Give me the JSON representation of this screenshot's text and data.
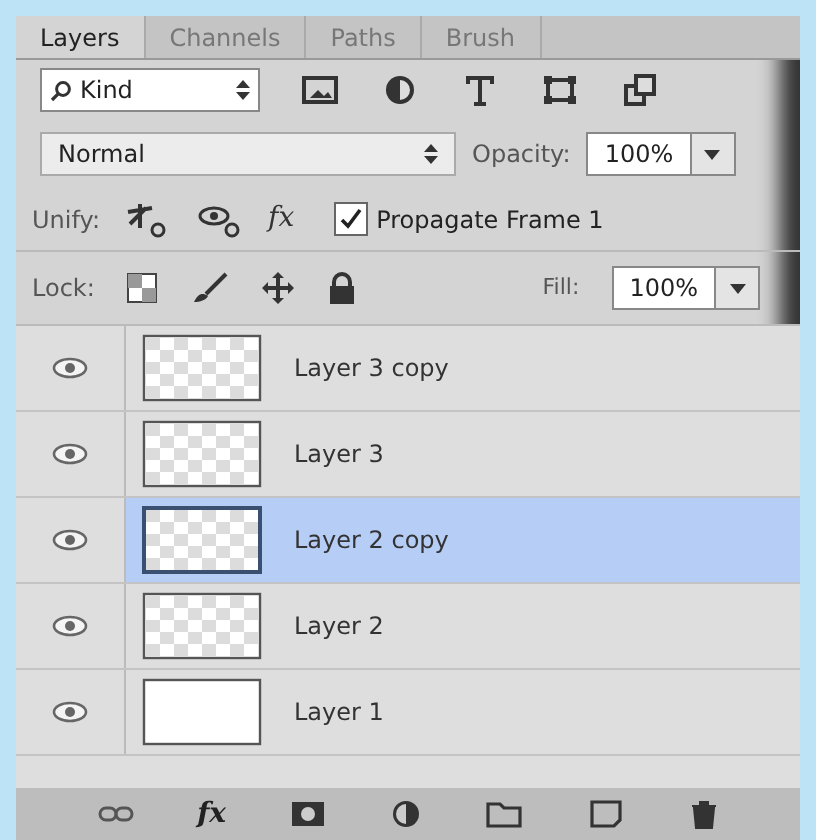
{
  "tabs": [
    {
      "label": "Layers",
      "selected": true
    },
    {
      "label": "Channels",
      "selected": false
    },
    {
      "label": "Paths",
      "selected": false
    },
    {
      "label": "Brush",
      "selected": false
    }
  ],
  "filter": {
    "value": "Kind"
  },
  "blend": {
    "mode": "Normal",
    "opacity_label": "Opacity:",
    "opacity": "100%"
  },
  "unify": {
    "label": "Unify:",
    "style_label": "fx",
    "propagate": {
      "label": "Propagate Frame 1",
      "checked": true
    }
  },
  "lock": {
    "label": "Lock:",
    "fill_label": "Fill:",
    "fill": "100%"
  },
  "layers": [
    {
      "name": "Layer 3 copy",
      "visible": true,
      "selected": false,
      "transparent": true
    },
    {
      "name": "Layer 3",
      "visible": true,
      "selected": false,
      "transparent": true
    },
    {
      "name": "Layer 2 copy",
      "visible": true,
      "selected": true,
      "transparent": true
    },
    {
      "name": "Layer 2",
      "visible": true,
      "selected": false,
      "transparent": true
    },
    {
      "name": "Layer 1",
      "visible": true,
      "selected": false,
      "transparent": false
    }
  ],
  "bottom_toolbar": {
    "effects_label": "fx"
  }
}
